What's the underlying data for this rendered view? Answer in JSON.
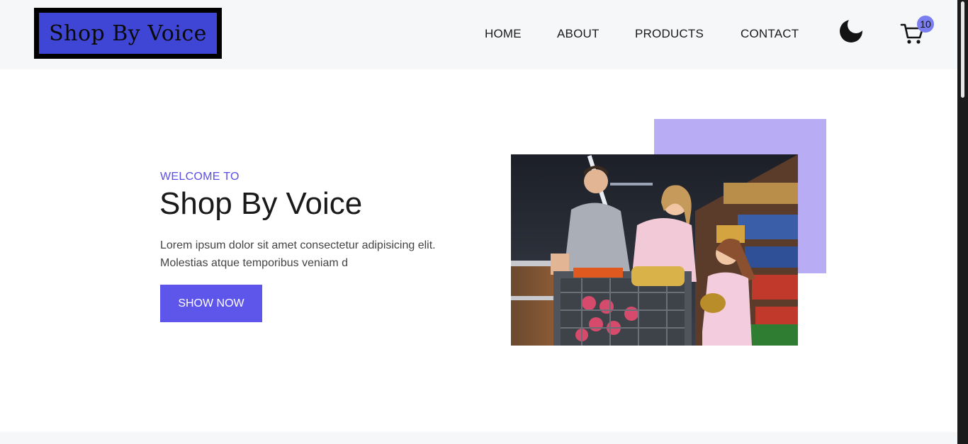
{
  "brand": {
    "name": "Shop By Voice"
  },
  "nav": {
    "items": [
      {
        "label": "HOME"
      },
      {
        "label": "ABOUT"
      },
      {
        "label": "PRODUCTS"
      },
      {
        "label": "CONTACT"
      }
    ]
  },
  "header_icons": {
    "theme_toggle": "moon-icon",
    "cart": "cart-icon",
    "cart_count": "10"
  },
  "hero": {
    "eyebrow": "WELCOME TO",
    "title": "Shop By Voice",
    "description": "Lorem ipsum dolor sit amet consectetur adipisicing elit. Molestias atque temporibus veniam d",
    "cta_label": "SHOW NOW"
  },
  "colors": {
    "accent": "#5e55ea",
    "accent_light": "#b8adf5",
    "logo_bg": "#3f46d6",
    "header_bg": "#f6f7f9",
    "badge": "#7b7ef0"
  }
}
